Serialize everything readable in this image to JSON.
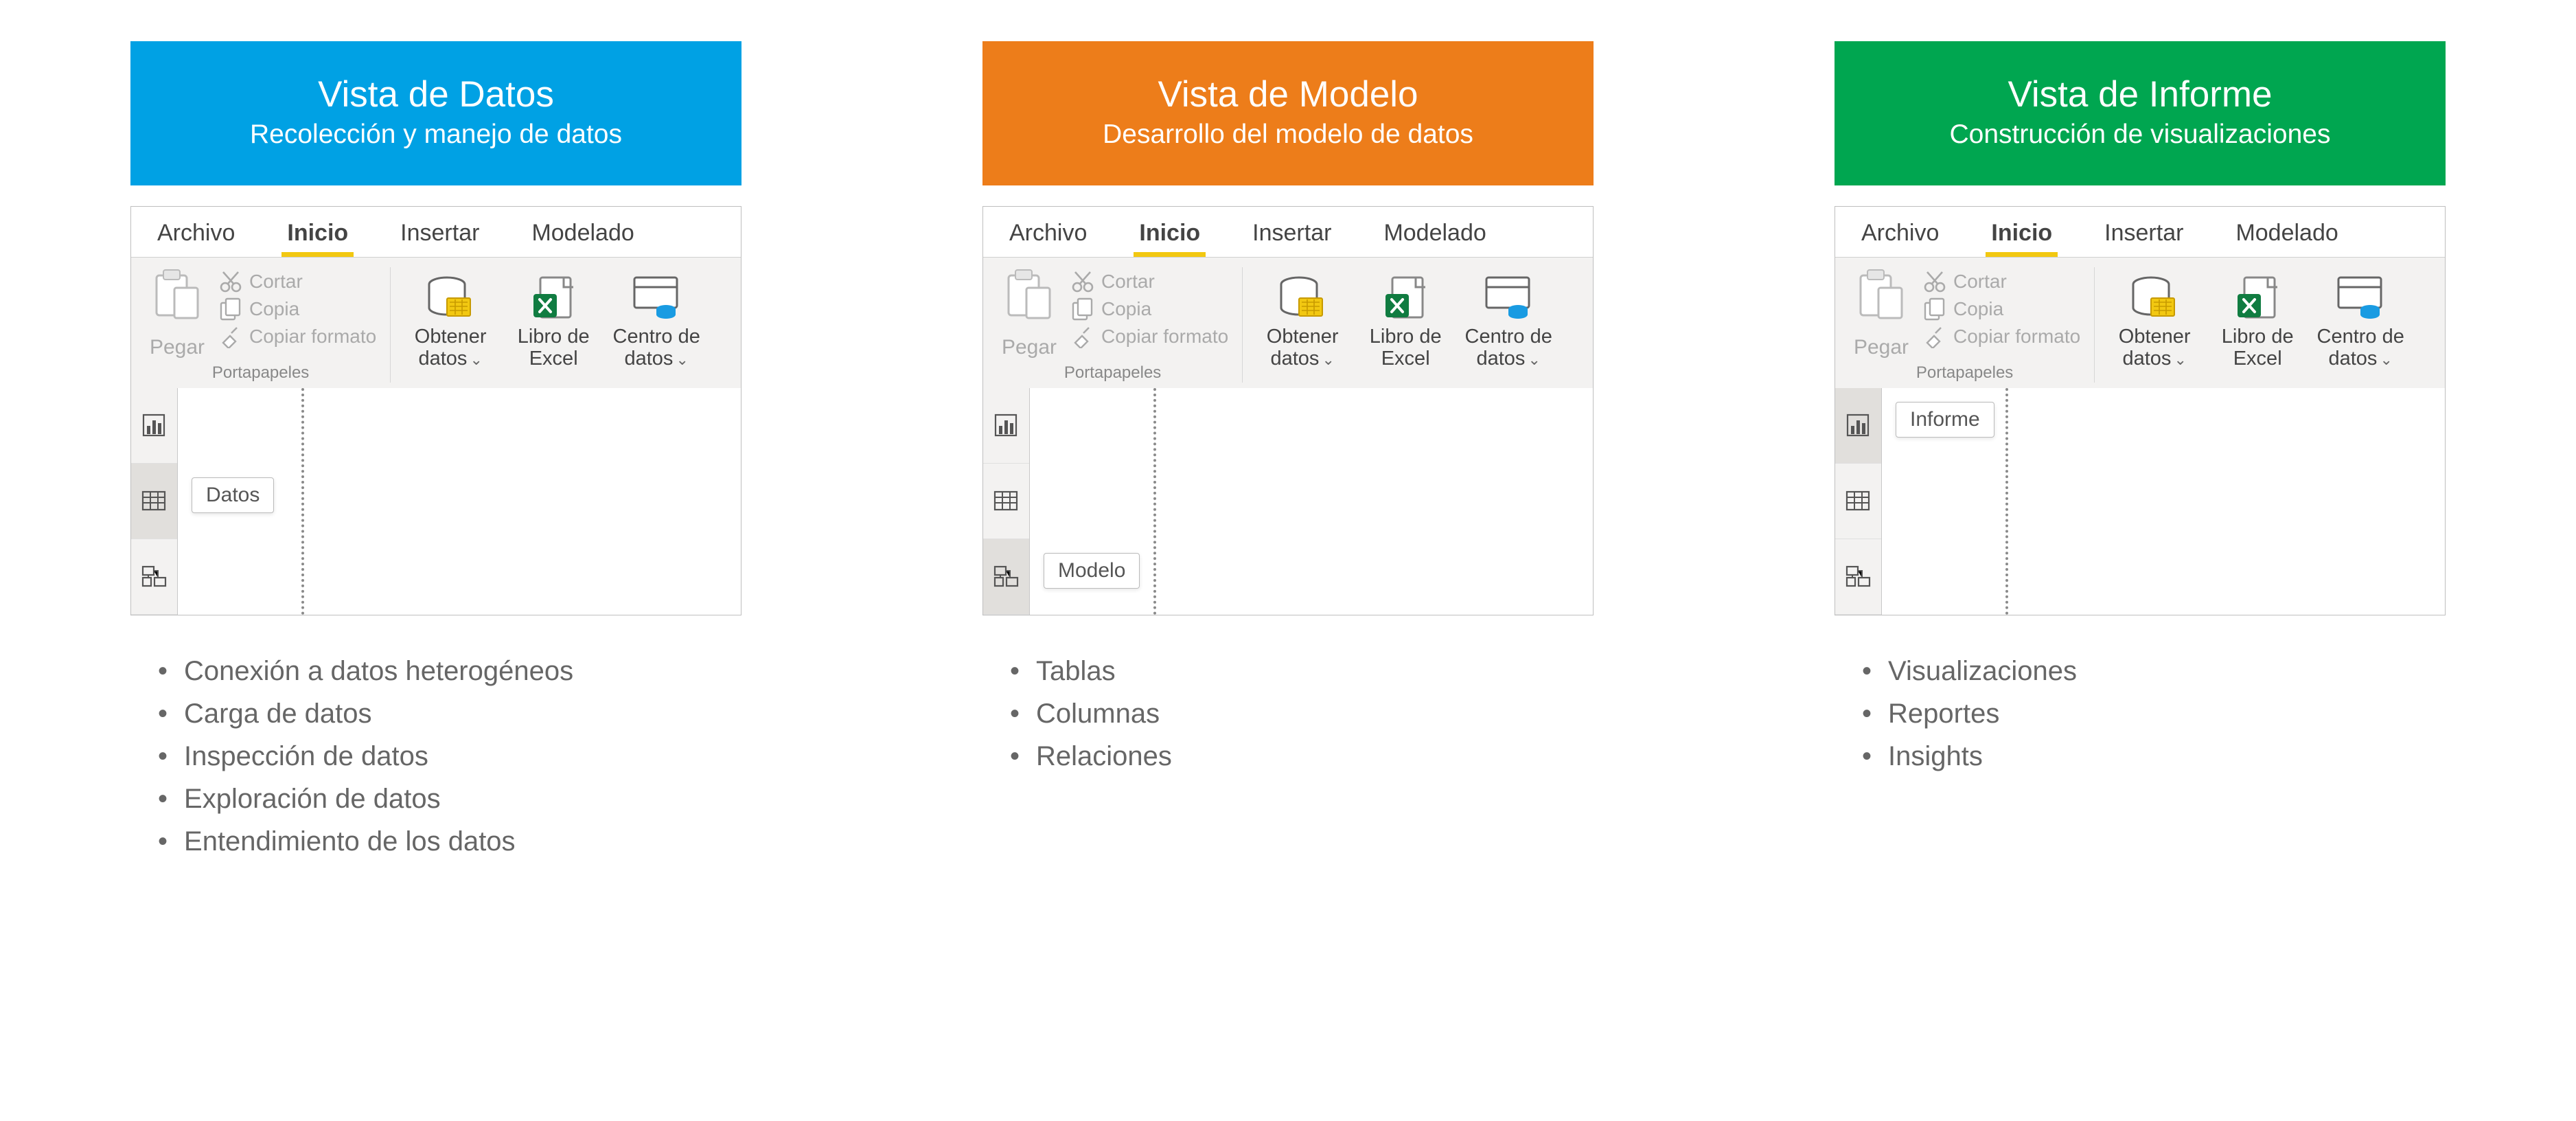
{
  "ribbon": {
    "tabs": [
      "Archivo",
      "Inicio",
      "Insertar",
      "Modelado"
    ],
    "active_tab": "Inicio",
    "clipboard_group": "Portapapeles",
    "paste": "Pegar",
    "cut": "Cortar",
    "copy": "Copia",
    "copy_format": "Copiar formato",
    "get_data": "Obtener\ndatos",
    "excel": "Libro de\nExcel",
    "data_center": "Centro de\ndatos",
    "dropdown_caret": "⌄"
  },
  "columns": [
    {
      "color": "blue",
      "title": "Vista de Datos",
      "subtitle": "Recolección y manejo  de datos",
      "tooltip_label": "Datos",
      "tooltip_slot": 1,
      "bullets": [
        "Conexión a datos heterogéneos",
        "Carga de datos",
        "Inspección de datos",
        "Exploración de datos",
        "Entendimiento de los datos"
      ]
    },
    {
      "color": "orange",
      "title": "Vista de Modelo",
      "subtitle": "Desarrollo del modelo de datos",
      "tooltip_label": "Modelo",
      "tooltip_slot": 2,
      "bullets": [
        "Tablas",
        "Columnas",
        "Relaciones"
      ]
    },
    {
      "color": "green",
      "title": "Vista de Informe",
      "subtitle": "Construcción de visualizaciones",
      "tooltip_label": "Informe",
      "tooltip_slot": 0,
      "bullets": [
        "Visualizaciones",
        "Reportes",
        "Insights"
      ]
    }
  ]
}
